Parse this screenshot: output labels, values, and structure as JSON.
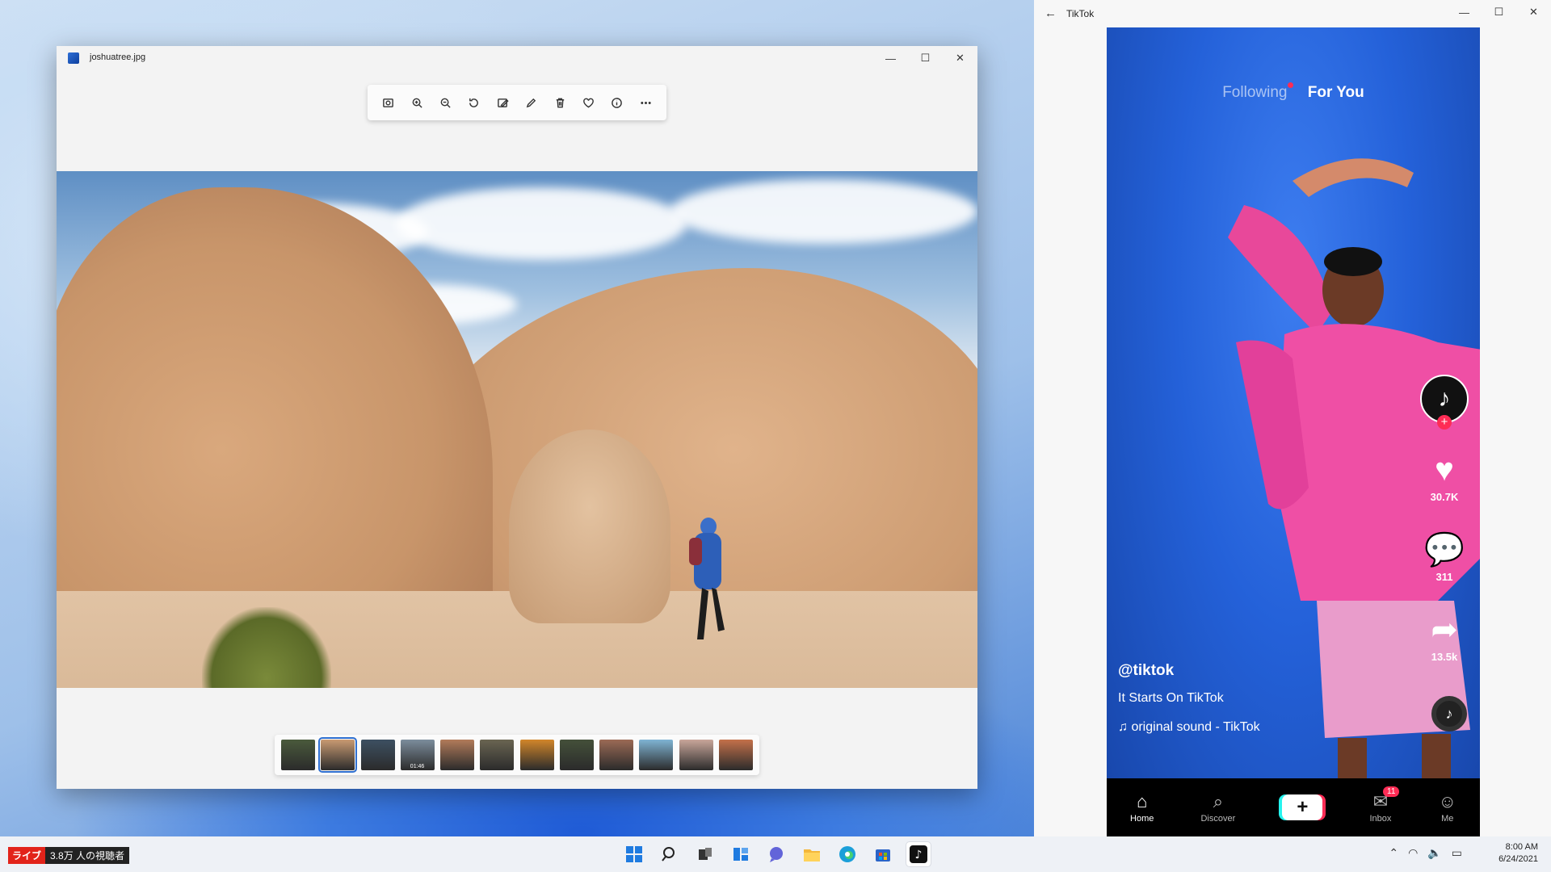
{
  "photos_window": {
    "title": "joshuatree.jpg",
    "controls": {
      "minimize": "—",
      "maximize": "☐",
      "close": "✕"
    },
    "toolbar": [
      "crop-icon",
      "zoom-in-icon",
      "zoom-out-icon",
      "rotate-icon",
      "edit-icon",
      "draw-icon",
      "delete-icon",
      "favorite-icon",
      "info-icon",
      "more-icon"
    ],
    "filmstrip": {
      "thumbnails": [
        {
          "color": "#4a5a3c"
        },
        {
          "color": "#c99a72",
          "selected": true
        },
        {
          "color": "#3d5062"
        },
        {
          "color": "#7c8d9c",
          "duration": "01:46"
        },
        {
          "color": "#b27b5a"
        },
        {
          "color": "#6a6552"
        },
        {
          "color": "#d2862a"
        },
        {
          "color": "#44503a"
        },
        {
          "color": "#9b6a55"
        },
        {
          "color": "#7fb4d4"
        },
        {
          "color": "#c9a69a"
        },
        {
          "color": "#c4714a"
        }
      ]
    }
  },
  "tiktok_window": {
    "title": "TikTok",
    "back": "←",
    "tabs": {
      "following": "Following",
      "for_you": "For You"
    },
    "actions": {
      "likes": "30.7K",
      "comments": "311",
      "shares": "13.5k"
    },
    "username": "@tiktok",
    "caption": "It Starts On TikTok",
    "sound": "original sound - TikTok",
    "nav": {
      "home": "Home",
      "discover": "Discover",
      "inbox": "Inbox",
      "inbox_badge": "11",
      "me": "Me"
    }
  },
  "taskbar": {
    "live_label": "ライブ",
    "viewers": "3.8万 人の視聴者",
    "time": "8:00 AM",
    "date": "6/24/2021"
  },
  "colors": {
    "accent": "#2f6fd0",
    "tiktok_red": "#fe2c55",
    "tiktok_cyan": "#25f4ee"
  }
}
